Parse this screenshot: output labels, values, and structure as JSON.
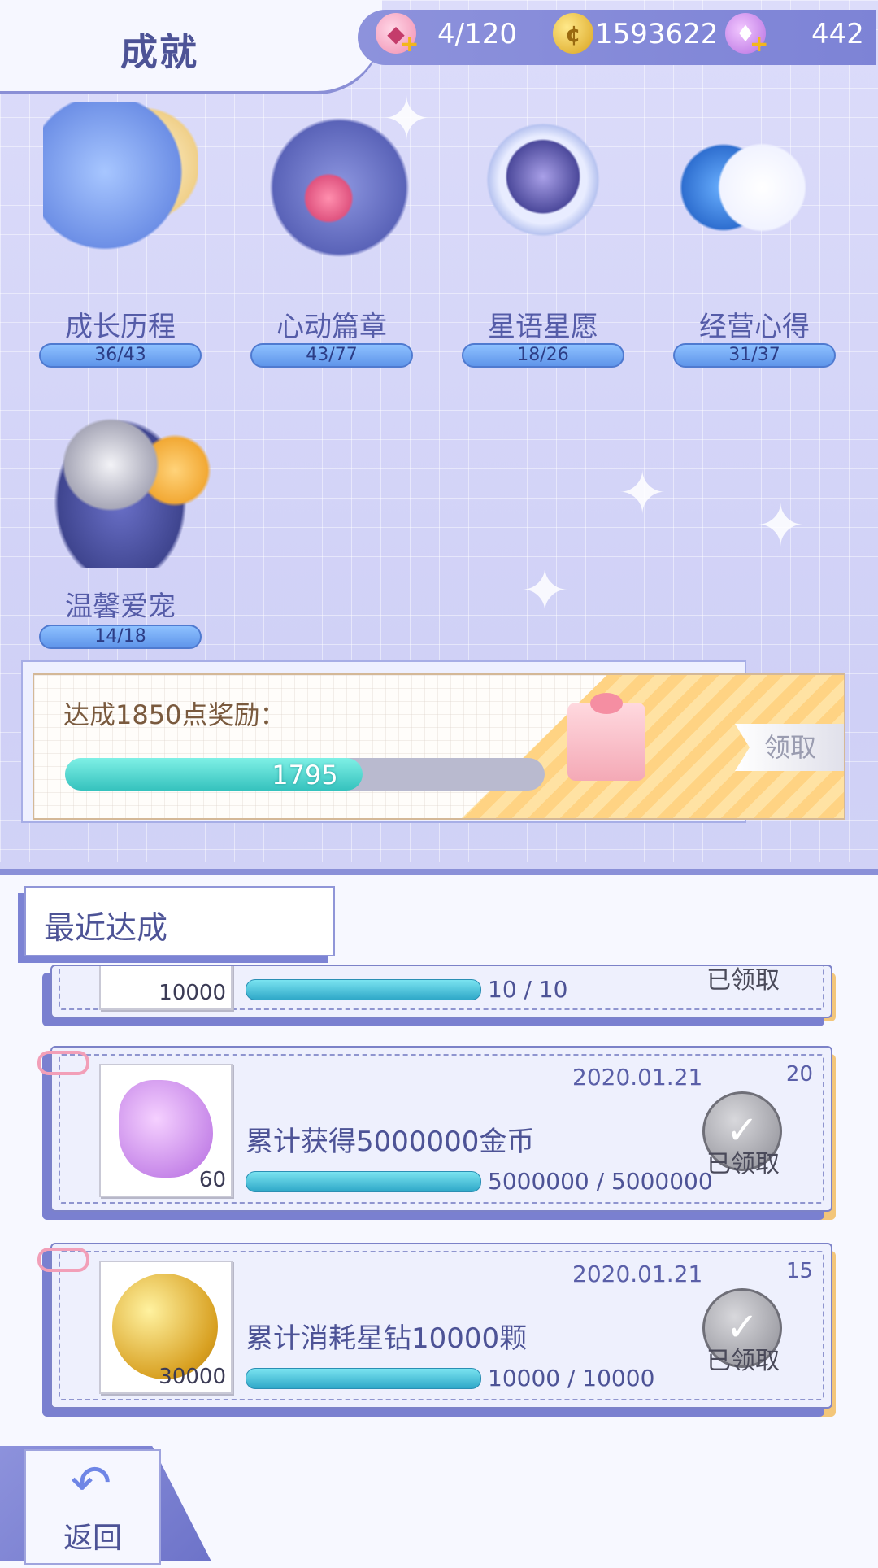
{
  "header": {
    "title": "成就",
    "resources": [
      {
        "icon": "cake-icon",
        "value": "4/120"
      },
      {
        "icon": "coin-icon",
        "value": "1593622"
      },
      {
        "icon": "swan-crystal-icon",
        "value": "442"
      }
    ]
  },
  "categories": [
    {
      "label": "成长历程",
      "progress": "36/43",
      "icon": "rose-hourglass-icon"
    },
    {
      "label": "心动篇章",
      "progress": "43/77",
      "icon": "heart-locket-box-icon"
    },
    {
      "label": "星语星愿",
      "progress": "18/26",
      "icon": "star-globe-icon"
    },
    {
      "label": "经营心得",
      "progress": "31/37",
      "icon": "teacup-flowers-icon"
    },
    {
      "label": "温馨爱宠",
      "progress": "14/18",
      "icon": "cat-cushion-icon"
    }
  ],
  "reward": {
    "title": "达成1850点奖励：",
    "current": "1795",
    "fraction": 0.62,
    "claim_label": "领取"
  },
  "recent": {
    "title": "最近达成",
    "items": [
      {
        "item_count": "10000",
        "progress": "10 / 10",
        "claimed_label": "已领取"
      },
      {
        "date": "2020.01.21",
        "points": "20",
        "description": "累计获得5000000金币",
        "item_count": "60",
        "progress": "5000000 / 5000000",
        "claimed_label": "已领取",
        "item_icon": "swan-crystal-icon"
      },
      {
        "date": "2020.01.21",
        "points": "15",
        "description": "累计消耗星钻10000颗",
        "item_count": "30000",
        "progress": "10000 / 10000",
        "claimed_label": "已领取",
        "item_icon": "coin-icon"
      }
    ]
  },
  "back": {
    "label": "返回"
  },
  "colors": {
    "accent": "#7d83d6",
    "progress": "#35c2be",
    "gold": "#f3c67a"
  }
}
